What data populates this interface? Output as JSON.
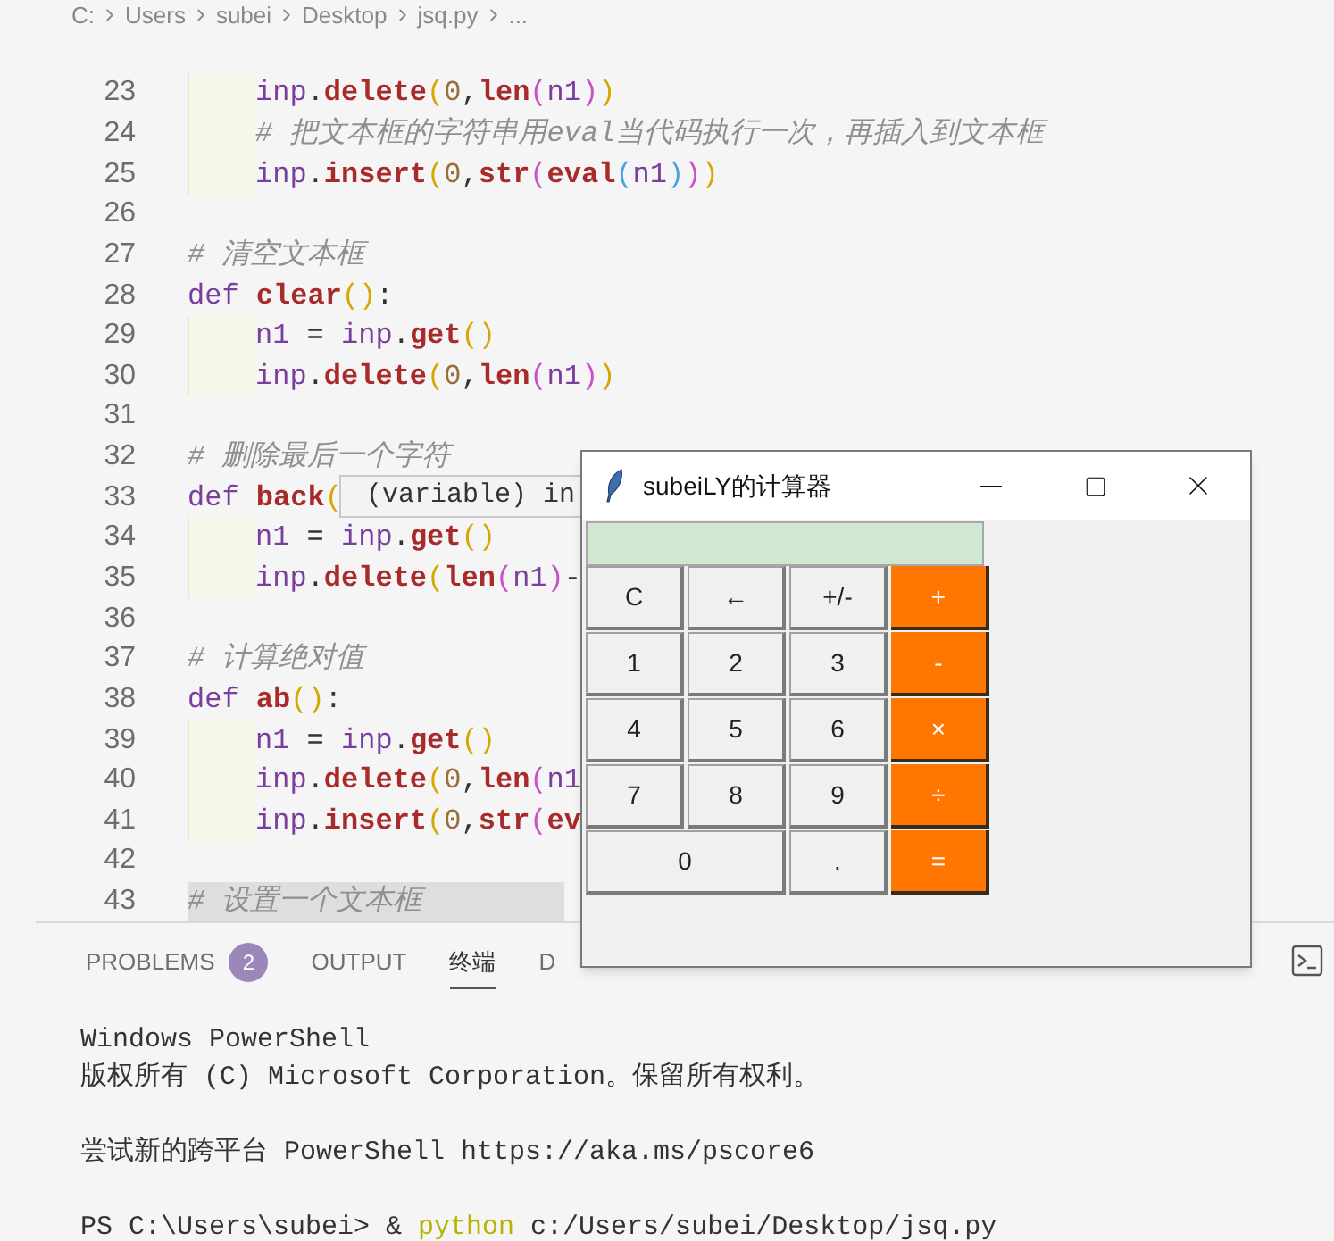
{
  "breadcrumb": [
    "C:",
    "Users",
    "subei",
    "Desktop",
    "jsq.py",
    "..."
  ],
  "code_lines": [
    {
      "number": "23",
      "indented": true,
      "selected": false,
      "tokens": [
        {
          "kind": "var",
          "text": "inp"
        },
        {
          "kind": "plain",
          "text": "."
        },
        {
          "kind": "func",
          "text": "delete"
        },
        {
          "kind": "bracket",
          "text": "(",
          "color": "#d4a800"
        },
        {
          "kind": "number",
          "text": "0"
        },
        {
          "kind": "plain",
          "text": ","
        },
        {
          "kind": "func",
          "text": "len"
        },
        {
          "kind": "bracket",
          "text": "(",
          "color": "#c84fc8"
        },
        {
          "kind": "var",
          "text": "n1"
        },
        {
          "kind": "bracket",
          "text": ")",
          "color": "#c84fc8"
        },
        {
          "kind": "bracket",
          "text": ")",
          "color": "#d4a800"
        }
      ]
    },
    {
      "number": "24",
      "indented": true,
      "selected": false,
      "tokens": [
        {
          "kind": "comment",
          "text": "# 把文本框的字符串用eval当代码执行一次，再插入到文本框"
        }
      ]
    },
    {
      "number": "25",
      "indented": true,
      "selected": false,
      "tokens": [
        {
          "kind": "var",
          "text": "inp"
        },
        {
          "kind": "plain",
          "text": "."
        },
        {
          "kind": "func",
          "text": "insert"
        },
        {
          "kind": "bracket",
          "text": "(",
          "color": "#d4a800"
        },
        {
          "kind": "number",
          "text": "0"
        },
        {
          "kind": "plain",
          "text": ","
        },
        {
          "kind": "func",
          "text": "str"
        },
        {
          "kind": "bracket",
          "text": "(",
          "color": "#c84fc8"
        },
        {
          "kind": "func",
          "text": "eval"
        },
        {
          "kind": "bracket",
          "text": "(",
          "color": "#4aa3e0"
        },
        {
          "kind": "var",
          "text": "n1"
        },
        {
          "kind": "bracket",
          "text": ")",
          "color": "#4aa3e0"
        },
        {
          "kind": "bracket",
          "text": ")",
          "color": "#c84fc8"
        },
        {
          "kind": "bracket",
          "text": ")",
          "color": "#d4a800"
        }
      ]
    },
    {
      "number": "26"
    },
    {
      "number": "27",
      "indented": false,
      "selected": false,
      "tokens": [
        {
          "kind": "comment",
          "text": "# 清空文本框"
        }
      ]
    },
    {
      "number": "28",
      "indented": false,
      "selected": false,
      "tokens": [
        {
          "kind": "keyword",
          "text": "def"
        },
        {
          "kind": "func",
          "text": "clear"
        },
        {
          "kind": "bracket",
          "text": "(",
          "color": "#d4a800"
        },
        {
          "kind": "bracket",
          "text": ")",
          "color": "#d4a800"
        },
        {
          "kind": "plain",
          "text": ":"
        }
      ]
    },
    {
      "number": "29",
      "indented": true,
      "selected": false,
      "tokens": [
        {
          "kind": "var",
          "text": "n1"
        },
        {
          "kind": "plain",
          "text": " = "
        },
        {
          "kind": "var",
          "text": "inp"
        },
        {
          "kind": "plain",
          "text": "."
        },
        {
          "kind": "func",
          "text": "get"
        },
        {
          "kind": "bracket",
          "text": "(",
          "color": "#d4a800"
        },
        {
          "kind": "bracket",
          "text": ")",
          "color": "#d4a800"
        }
      ]
    },
    {
      "number": "30",
      "indented": true,
      "selected": false,
      "tokens": [
        {
          "kind": "var",
          "text": "inp"
        },
        {
          "kind": "plain",
          "text": "."
        },
        {
          "kind": "func",
          "text": "delete"
        },
        {
          "kind": "bracket",
          "text": "(",
          "color": "#d4a800"
        },
        {
          "kind": "number",
          "text": "0"
        },
        {
          "kind": "plain",
          "text": ","
        },
        {
          "kind": "func",
          "text": "len"
        },
        {
          "kind": "bracket",
          "text": "(",
          "color": "#c84fc8"
        },
        {
          "kind": "var",
          "text": "n1"
        },
        {
          "kind": "bracket",
          "text": ")",
          "color": "#c84fc8"
        },
        {
          "kind": "bracket",
          "text": ")",
          "color": "#d4a800"
        }
      ]
    },
    {
      "number": "31"
    },
    {
      "number": "32",
      "indented": false,
      "selected": false,
      "tokens": [
        {
          "kind": "comment",
          "text": "# 删除最后一个字符"
        }
      ]
    },
    {
      "number": "33",
      "indented": false,
      "selected": false,
      "tokens": [
        {
          "kind": "keyword",
          "text": "def"
        },
        {
          "kind": "func",
          "text": "back"
        },
        {
          "kind": "bracket",
          "text": "(",
          "color": "#d4a800"
        }
      ]
    },
    {
      "number": "34",
      "indented": true,
      "selected": false,
      "tokens": [
        {
          "kind": "var",
          "text": "n1"
        },
        {
          "kind": "plain",
          "text": " = "
        },
        {
          "kind": "var",
          "text": "inp"
        },
        {
          "kind": "plain",
          "text": "."
        },
        {
          "kind": "func",
          "text": "get"
        },
        {
          "kind": "bracket",
          "text": "(",
          "color": "#d4a800"
        },
        {
          "kind": "bracket",
          "text": ")",
          "color": "#d4a800"
        }
      ]
    },
    {
      "number": "35",
      "indented": true,
      "selected": false,
      "tokens": [
        {
          "kind": "var",
          "text": "inp"
        },
        {
          "kind": "plain",
          "text": "."
        },
        {
          "kind": "func",
          "text": "delete"
        },
        {
          "kind": "bracket",
          "text": "(",
          "color": "#d4a800"
        },
        {
          "kind": "func",
          "text": "len"
        },
        {
          "kind": "bracket",
          "text": "(",
          "color": "#c84fc8"
        },
        {
          "kind": "var",
          "text": "n1"
        },
        {
          "kind": "bracket",
          "text": ")",
          "color": "#c84fc8"
        },
        {
          "kind": "plain",
          "text": "-"
        }
      ]
    },
    {
      "number": "36"
    },
    {
      "number": "37",
      "indented": false,
      "selected": false,
      "tokens": [
        {
          "kind": "comment",
          "text": "# 计算绝对值"
        }
      ]
    },
    {
      "number": "38",
      "indented": false,
      "selected": false,
      "tokens": [
        {
          "kind": "keyword",
          "text": "def"
        },
        {
          "kind": "func",
          "text": "ab"
        },
        {
          "kind": "bracket",
          "text": "(",
          "color": "#d4a800"
        },
        {
          "kind": "bracket",
          "text": ")",
          "color": "#d4a800"
        },
        {
          "kind": "plain",
          "text": ":"
        }
      ]
    },
    {
      "number": "39",
      "indented": true,
      "selected": false,
      "tokens": [
        {
          "kind": "var",
          "text": "n1"
        },
        {
          "kind": "plain",
          "text": " = "
        },
        {
          "kind": "var",
          "text": "inp"
        },
        {
          "kind": "plain",
          "text": "."
        },
        {
          "kind": "func",
          "text": "get"
        },
        {
          "kind": "bracket",
          "text": "(",
          "color": "#d4a800"
        },
        {
          "kind": "bracket",
          "text": ")",
          "color": "#d4a800"
        }
      ]
    },
    {
      "number": "40",
      "indented": true,
      "selected": false,
      "tokens": [
        {
          "kind": "var",
          "text": "inp"
        },
        {
          "kind": "plain",
          "text": "."
        },
        {
          "kind": "func",
          "text": "delete"
        },
        {
          "kind": "bracket",
          "text": "(",
          "color": "#d4a800"
        },
        {
          "kind": "number",
          "text": "0"
        },
        {
          "kind": "plain",
          "text": ","
        },
        {
          "kind": "func",
          "text": "len"
        },
        {
          "kind": "bracket",
          "text": "(",
          "color": "#c84fc8"
        },
        {
          "kind": "var",
          "text": "n1"
        }
      ]
    },
    {
      "number": "41",
      "indented": true,
      "selected": false,
      "tokens": [
        {
          "kind": "var",
          "text": "inp"
        },
        {
          "kind": "plain",
          "text": "."
        },
        {
          "kind": "func",
          "text": "insert"
        },
        {
          "kind": "bracket",
          "text": "(",
          "color": "#d4a800"
        },
        {
          "kind": "number",
          "text": "0"
        },
        {
          "kind": "plain",
          "text": ","
        },
        {
          "kind": "func",
          "text": "str"
        },
        {
          "kind": "bracket",
          "text": "(",
          "color": "#c84fc8"
        },
        {
          "kind": "func",
          "text": "ev"
        }
      ]
    },
    {
      "number": "42"
    },
    {
      "number": "43",
      "indented": false,
      "selected": true,
      "tokens": [
        {
          "kind": "comment",
          "text": "# 设置一个文本框"
        }
      ]
    }
  ],
  "hover_tooltip": {
    "text": "(variable) in"
  },
  "panel": {
    "tabs": [
      {
        "label": "PROBLEMS",
        "badge": "2",
        "selected": false
      },
      {
        "label": "OUTPUT",
        "selected": false
      },
      {
        "label": "终端",
        "selected": true
      },
      {
        "label": "D",
        "selected": false
      }
    ],
    "terminal_blocks": [
      [
        [
          {
            "kind": "plain",
            "text": "Windows PowerShell"
          }
        ],
        [
          {
            "kind": "plain",
            "text": "版权所有 (C) Microsoft Corporation。保留所有权利。"
          }
        ]
      ],
      [
        [
          {
            "kind": "plain",
            "text": "尝试新的跨平台 PowerShell https://aka.ms/pscore6"
          }
        ]
      ],
      [
        [
          {
            "kind": "plain",
            "text": "PS C:\\Users\\subei> & "
          },
          {
            "kind": "command",
            "text": "python"
          },
          {
            "kind": "plain",
            "text": " c:/Users/subei/Desktop/jsq.py"
          }
        ]
      ]
    ]
  },
  "calculator": {
    "title": "subeiLY的计算器",
    "buttons": [
      {
        "label": "C",
        "kind": "normal"
      },
      {
        "label": "←",
        "kind": "normal"
      },
      {
        "label": "+/-",
        "kind": "normal"
      },
      {
        "label": "+",
        "kind": "operator"
      },
      {
        "label": "1",
        "kind": "normal"
      },
      {
        "label": "2",
        "kind": "normal"
      },
      {
        "label": "3",
        "kind": "normal"
      },
      {
        "label": "-",
        "kind": "operator"
      },
      {
        "label": "4",
        "kind": "normal"
      },
      {
        "label": "5",
        "kind": "normal"
      },
      {
        "label": "6",
        "kind": "normal"
      },
      {
        "label": "×",
        "kind": "operator"
      },
      {
        "label": "7",
        "kind": "normal"
      },
      {
        "label": "8",
        "kind": "normal"
      },
      {
        "label": "9",
        "kind": "normal"
      },
      {
        "label": "÷",
        "kind": "operator"
      },
      {
        "label": "0",
        "kind": "wide"
      },
      {
        "label": ".",
        "kind": "normal"
      },
      {
        "label": "=",
        "kind": "operator"
      }
    ]
  }
}
